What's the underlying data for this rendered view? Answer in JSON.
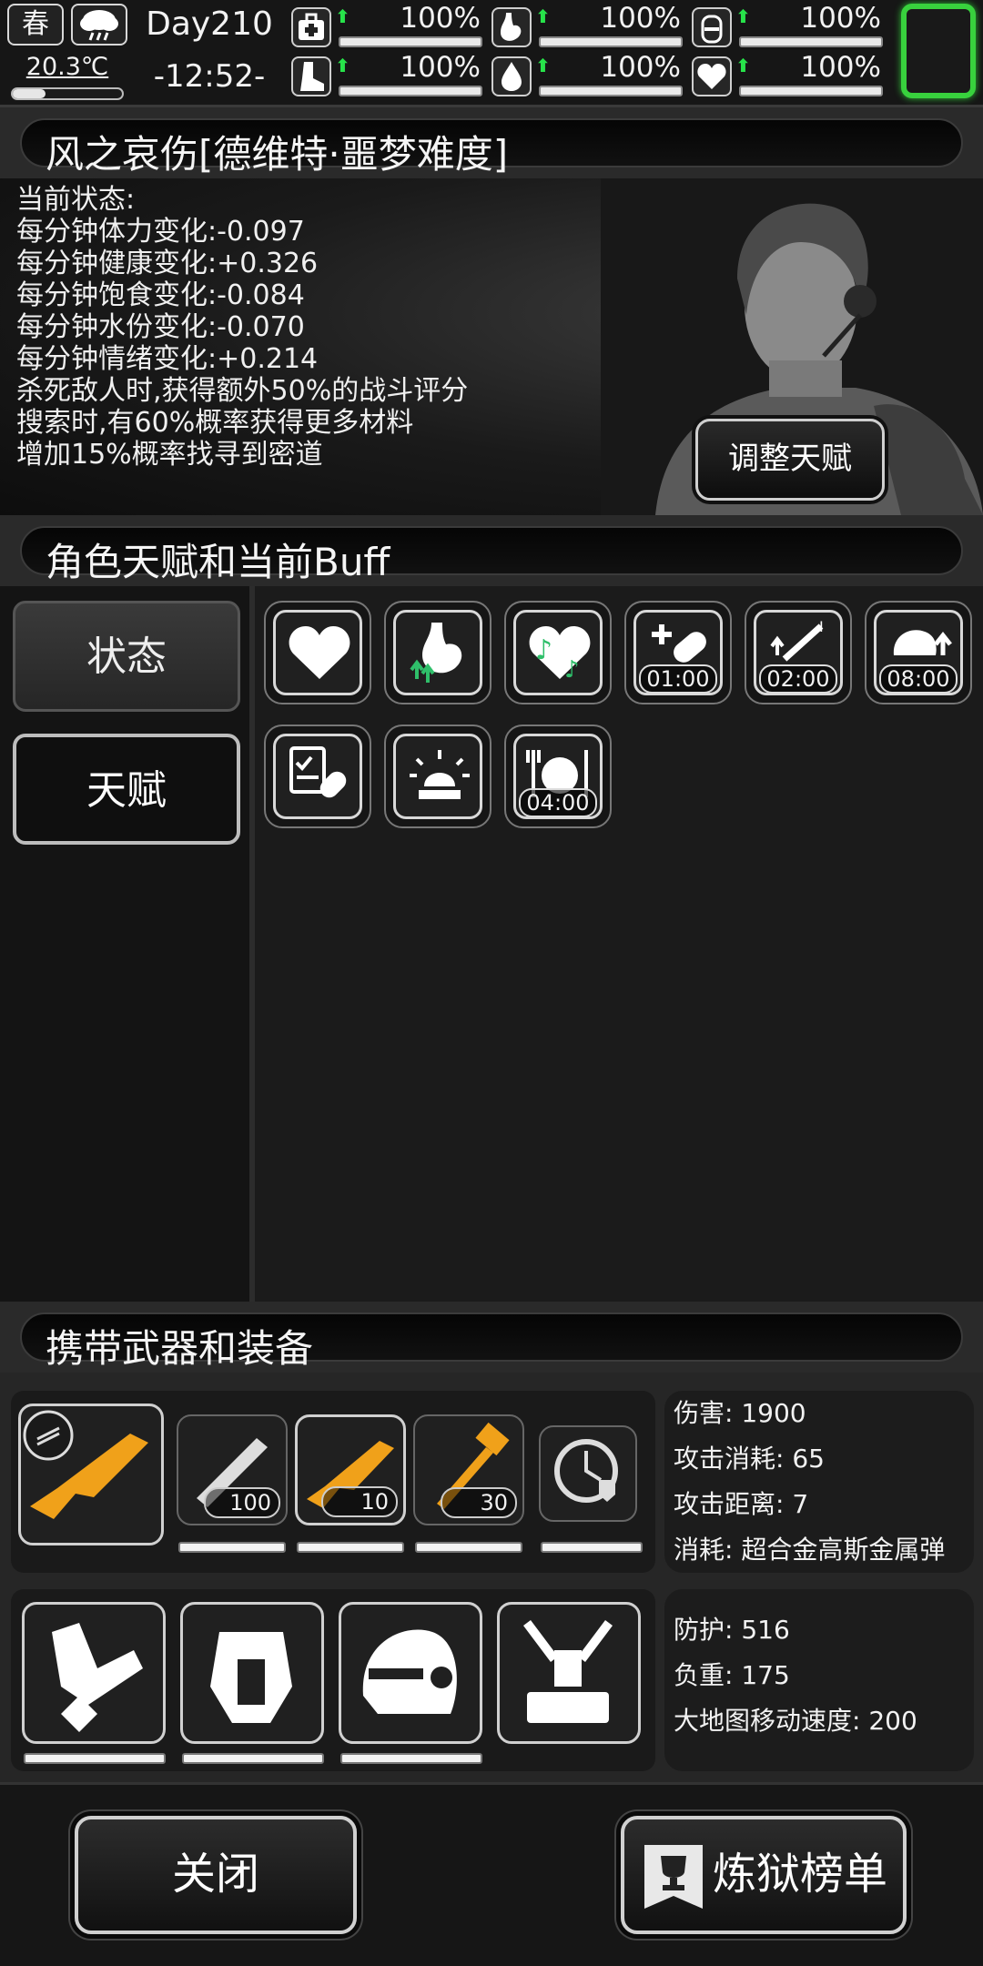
{
  "topbar": {
    "season": "春",
    "temperature": "20.3℃",
    "day": "Day210",
    "time": "-12:52-",
    "stats": [
      {
        "icon": "medkit-icon",
        "value": "100%"
      },
      {
        "icon": "stomach-icon",
        "value": "100%"
      },
      {
        "icon": "bottle-icon",
        "value": "100%"
      },
      {
        "icon": "boot-icon",
        "value": "100%"
      },
      {
        "icon": "water-drop-icon",
        "value": "100%"
      },
      {
        "icon": "heart-icon",
        "value": "100%"
      }
    ],
    "stat_level": 1.0
  },
  "character": {
    "title": "风之哀伤[德维特·噩梦难度]",
    "status_heading": "当前状态:",
    "status_lines": [
      "每分钟体力变化:-0.097",
      "每分钟健康变化:+0.326",
      "每分钟饱食变化:-0.084",
      "每分钟水份变化:-0.070",
      "每分钟情绪变化:+0.214",
      "杀死敌人时,获得额外50%的战斗评分",
      "搜索时,有60%概率获得更多材料",
      "增加15%概率找寻到密道"
    ],
    "adjust_talent_label": "调整天赋"
  },
  "buffs": {
    "title": "角色天赋和当前Buff",
    "tab_status": "状态",
    "tab_talent": "天赋",
    "items": [
      {
        "icon": "heart-icon",
        "timer": ""
      },
      {
        "icon": "stomach-up-icon",
        "timer": ""
      },
      {
        "icon": "music-heart-icon",
        "timer": ""
      },
      {
        "icon": "medicine-pill-icon",
        "timer": "01:00"
      },
      {
        "icon": "syringe-up-icon",
        "timer": "02:00"
      },
      {
        "icon": "brain-up-icon",
        "timer": "08:00"
      },
      {
        "icon": "clipboard-pill-icon",
        "timer": ""
      },
      {
        "icon": "alarm-light-icon",
        "timer": ""
      },
      {
        "icon": "meal-icon",
        "timer": "04:00"
      }
    ]
  },
  "equipment": {
    "title": "携带武器和装备",
    "weapons": [
      {
        "icon": "shotgun-icon",
        "count": ""
      },
      {
        "icon": "minigun-icon",
        "count": "100"
      },
      {
        "icon": "shotgun-icon",
        "count": "10"
      },
      {
        "icon": "hammer-icon",
        "count": "30"
      },
      {
        "icon": "shield-watch-icon",
        "count": ""
      }
    ],
    "weapon_stats": [
      "伤害: 1900",
      "攻击消耗: 65",
      "攻击距离: 7",
      "消耗: 超合金高斯金属弹"
    ],
    "armor": [
      {
        "icon": "arm-armor-icon"
      },
      {
        "icon": "body-armor-icon"
      },
      {
        "icon": "helmet-icon"
      },
      {
        "icon": "exoskeleton-icon"
      }
    ],
    "armor_stats": [
      "防护: 516",
      "负重: 175",
      "大地图移动速度: 200"
    ]
  },
  "bottom": {
    "close_label": "关闭",
    "leaderboard_label": "炼狱榜单"
  },
  "colors": {
    "accent_green": "#38d13d",
    "arrow_green": "#27e34a",
    "weapon_orange": "#f0a11a"
  }
}
